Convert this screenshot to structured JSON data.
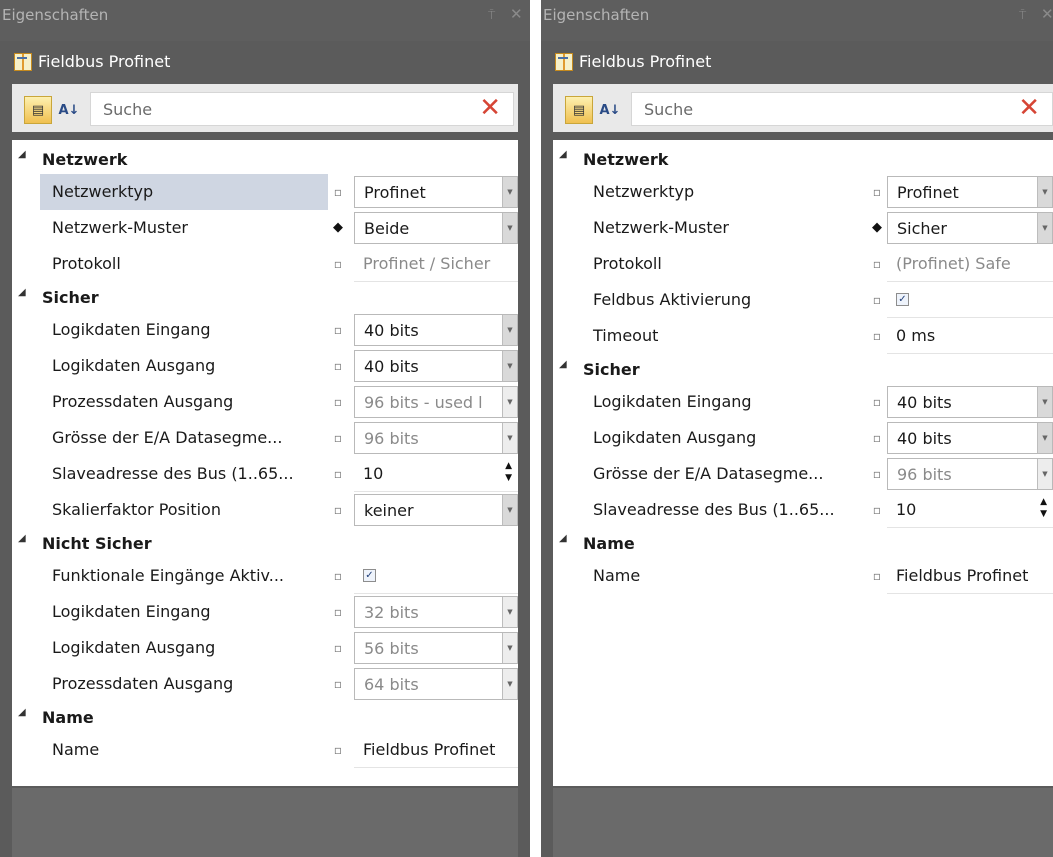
{
  "left": {
    "window_title": "Eigenschaften",
    "pin_glyph": "⍑",
    "close_glyph": "✕",
    "header_title": "Fieldbus Profinet",
    "search_placeholder": "Suche",
    "categories": [
      {
        "label": "Netzwerk",
        "props": [
          {
            "name": "Netzwerktyp",
            "marker": "square",
            "value": "Profinet",
            "kind": "combo",
            "selected": true
          },
          {
            "name": "Netzwerk-Muster",
            "marker": "diamond",
            "value": "Beide",
            "kind": "combo"
          },
          {
            "name": "Protokoll",
            "marker": "square",
            "value": "Profinet / Sicher",
            "kind": "readonly"
          }
        ]
      },
      {
        "label": "Sicher",
        "props": [
          {
            "name": "Logikdaten Eingang",
            "marker": "square",
            "value": "40 bits",
            "kind": "combo"
          },
          {
            "name": "Logikdaten Ausgang",
            "marker": "square",
            "value": "40 bits",
            "kind": "combo"
          },
          {
            "name": "Prozessdaten Ausgang",
            "marker": "square",
            "value": "96 bits - used l",
            "kind": "combo-disabled"
          },
          {
            "name": "Grösse der E/A Datasegme...",
            "marker": "square",
            "value": "96 bits",
            "kind": "combo-disabled"
          },
          {
            "name": "Slaveadresse des Bus (1..65...",
            "marker": "square",
            "value": "10",
            "kind": "spinner"
          },
          {
            "name": "Skalierfaktor Position",
            "marker": "square",
            "value": "keiner",
            "kind": "combo"
          }
        ]
      },
      {
        "label": "Nicht Sicher",
        "props": [
          {
            "name": "Funktionale Eingänge Aktiv...",
            "marker": "square",
            "value": "",
            "kind": "checkbox",
            "checked": true
          },
          {
            "name": "Logikdaten Eingang",
            "marker": "square",
            "value": "32 bits",
            "kind": "combo-disabled"
          },
          {
            "name": "Logikdaten Ausgang",
            "marker": "square",
            "value": "56 bits",
            "kind": "combo-disabled"
          },
          {
            "name": "Prozessdaten Ausgang",
            "marker": "square",
            "value": "64 bits",
            "kind": "combo-disabled"
          }
        ]
      },
      {
        "label": "Name",
        "props": [
          {
            "name": "Name",
            "marker": "square",
            "value": "Fieldbus Profinet",
            "kind": "text"
          }
        ]
      }
    ]
  },
  "right": {
    "window_title": "Eigenschaften",
    "pin_glyph": "⍑",
    "close_glyph": "✕",
    "header_title": "Fieldbus Profinet",
    "search_placeholder": "Suche",
    "categories": [
      {
        "label": "Netzwerk",
        "props": [
          {
            "name": "Netzwerktyp",
            "marker": "square",
            "value": "Profinet",
            "kind": "combo"
          },
          {
            "name": "Netzwerk-Muster",
            "marker": "diamond",
            "value": "Sicher",
            "kind": "combo"
          },
          {
            "name": "Protokoll",
            "marker": "square",
            "value": "(Profinet) Safe",
            "kind": "readonly"
          },
          {
            "name": "Feldbus Aktivierung",
            "marker": "square",
            "value": "",
            "kind": "checkbox",
            "checked": true
          },
          {
            "name": "Timeout",
            "marker": "square",
            "value": "0 ms",
            "kind": "text"
          }
        ]
      },
      {
        "label": "Sicher",
        "props": [
          {
            "name": "Logikdaten Eingang",
            "marker": "square",
            "value": "40 bits",
            "kind": "combo"
          },
          {
            "name": "Logikdaten Ausgang",
            "marker": "square",
            "value": "40 bits",
            "kind": "combo"
          },
          {
            "name": "Grösse der E/A Datasegme...",
            "marker": "square",
            "value": "96 bits",
            "kind": "combo-disabled"
          },
          {
            "name": "Slaveadresse des Bus (1..65...",
            "marker": "square",
            "value": "10",
            "kind": "spinner"
          }
        ]
      },
      {
        "label": "Name",
        "props": [
          {
            "name": "Name",
            "marker": "square",
            "value": "Fieldbus Profinet",
            "kind": "text"
          }
        ]
      }
    ]
  }
}
